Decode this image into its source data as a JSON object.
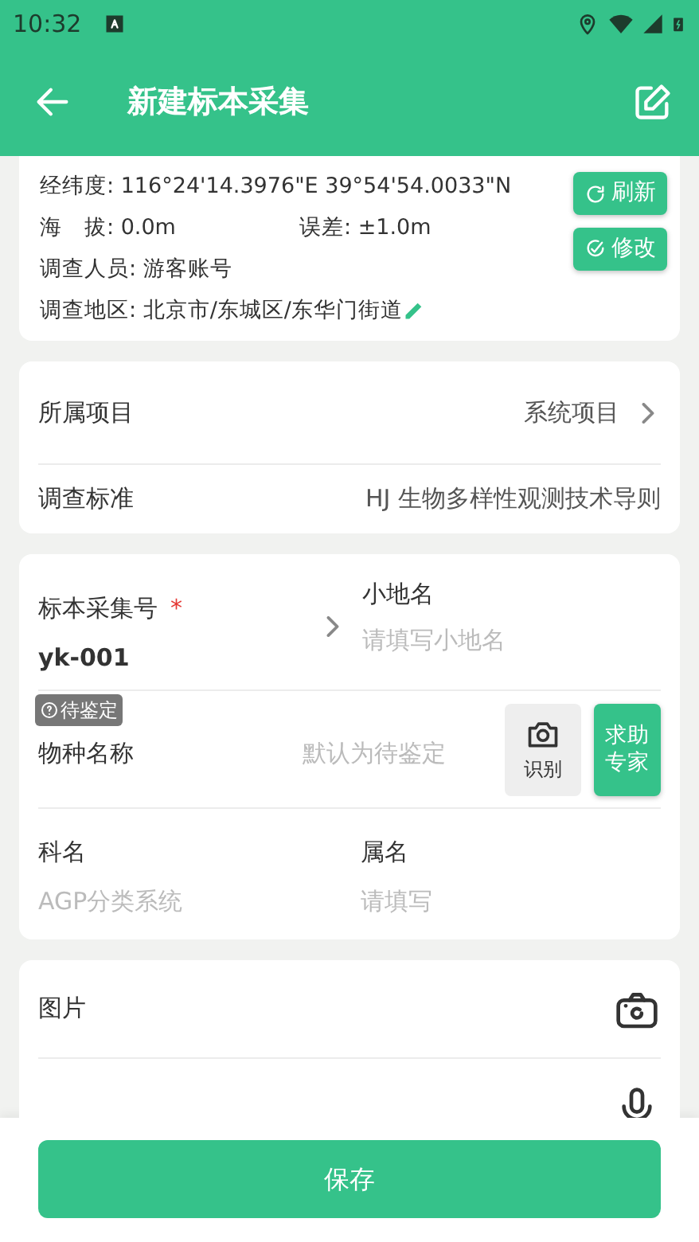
{
  "status_bar": {
    "time": "10:32"
  },
  "app_bar": {
    "title": "新建标本采集"
  },
  "location_card": {
    "coordinates": "经纬度: 116°24'14.3976\"E 39°54'54.0033\"N",
    "altitude": "海　拔: 0.0m",
    "error": "误差: ±1.0m",
    "surveyor": "调查人员: 游客账号",
    "region": "调查地区: 北京市/东城区/东华门街道",
    "buttons": [
      {
        "kind": "refresh",
        "label": "刷新"
      },
      {
        "kind": "edit",
        "label": "修改"
      }
    ]
  },
  "project_card": {
    "rows": [
      {
        "label": "所属项目",
        "value": "系统项目",
        "chevron": true
      },
      {
        "label": "调查标准",
        "value": "HJ 生物多样性观测技术导则",
        "chevron": false
      }
    ]
  },
  "specimen_card": {
    "number": {
      "label": "标本采集号",
      "required_mark": "*",
      "value": "yk-001"
    },
    "place": {
      "label": "小地名",
      "placeholder": "请填写小地名"
    },
    "species": {
      "badge": "待鉴定",
      "label": "物种名称",
      "placeholder": "默认为待鉴定",
      "identify_button": "识别",
      "expert_button": "求助专家"
    },
    "family": {
      "label": "科名",
      "placeholder": "AGP分类系统"
    },
    "genus": {
      "label": "属名",
      "placeholder": "请填写"
    }
  },
  "media_card": {
    "rows": [
      {
        "kind": "camera",
        "label": "图片"
      },
      {
        "kind": "mic"
      }
    ]
  },
  "save_button": "保存"
}
